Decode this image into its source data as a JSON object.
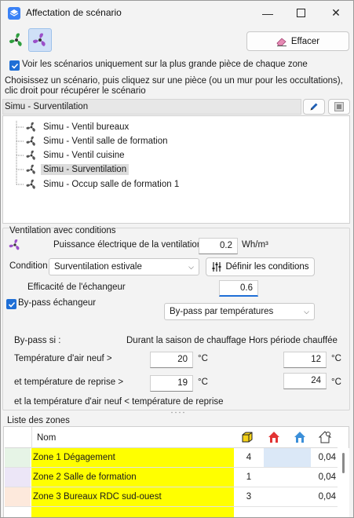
{
  "window": {
    "title": "Affectation de scénario"
  },
  "toolbar": {
    "erase_label": "Effacer"
  },
  "options": {
    "largest_room_only": "Voir les scénarios uniquement sur la plus grande pièce de chaque zone",
    "instructions": "Choisissez un scénario, puis cliquez sur une pièce (ou un mur pour les occultations), clic droit pour récupérer le scénario"
  },
  "tree": {
    "header": "Simu - Surventilation",
    "items": [
      {
        "label": "Simu - Ventil bureaux"
      },
      {
        "label": "Simu - Ventil salle de formation"
      },
      {
        "label": "Simu - Ventil cuisine"
      },
      {
        "label": "Simu - Surventilation",
        "selected": true
      },
      {
        "label": "Simu - Occup salle de formation 1"
      }
    ]
  },
  "ventilation": {
    "section_title": "Ventilation avec conditions",
    "power_label": "Puissance électrique de la ventilation",
    "power_value": "0.2",
    "power_unit": "Wh/m³",
    "condition_label": "Condition",
    "condition_value": "Surventilation estivale",
    "define_conditions_label": "Définir les conditions",
    "efficiency_label": "Efficacité de l'échangeur",
    "efficiency_value": "0.6",
    "bypass_label": "By-pass échangeur",
    "bypass_mode": "By-pass par températures",
    "bypass_if": "By-pass si :",
    "col_heating": "Durant la saison de chauffage",
    "col_outside": "Hors période chauffée",
    "fresh_air_label": "Température d'air neuf >",
    "fresh_air_heating": "20",
    "fresh_air_outside": "12",
    "extract_label": "et température de reprise >",
    "extract_heating": "19",
    "extract_outside": "24",
    "unit_c": "°C",
    "note": "et la température d'air neuf < température de reprise"
  },
  "zones": {
    "title": "Liste des zones",
    "col_name": "Nom",
    "rows": [
      {
        "name": "Zone 1 Dégagement",
        "count": "4",
        "value": "0,04",
        "swatch": "#e6f4e6"
      },
      {
        "name": "Zone 2 Salle de formation",
        "count": "1",
        "value": "0,04",
        "swatch": "#ece6f7"
      },
      {
        "name": "Zone 3 Bureaux RDC sud-ouest",
        "count": "3",
        "value": "0,04",
        "swatch": "#fde9dc"
      }
    ]
  },
  "colors": {
    "accent": "#1f6fd6",
    "zone_highlight": "#ffff00",
    "selected_cell": "#dbe8f7"
  }
}
